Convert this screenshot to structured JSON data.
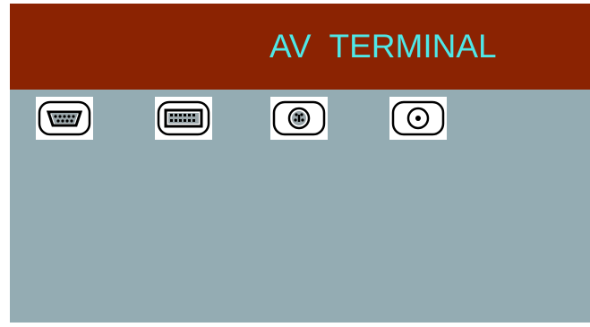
{
  "header": {
    "title": "AV  TERMINAL"
  },
  "ports": [
    {
      "icon": "vga-connector-icon"
    },
    {
      "icon": "dvi-connector-icon"
    },
    {
      "icon": "s-video-connector-icon"
    },
    {
      "icon": "composite-video-connector-icon"
    }
  ],
  "colors": {
    "header_background": "#8b2302",
    "title_text": "#4fe7e7",
    "panel_background": "#94acb3"
  }
}
